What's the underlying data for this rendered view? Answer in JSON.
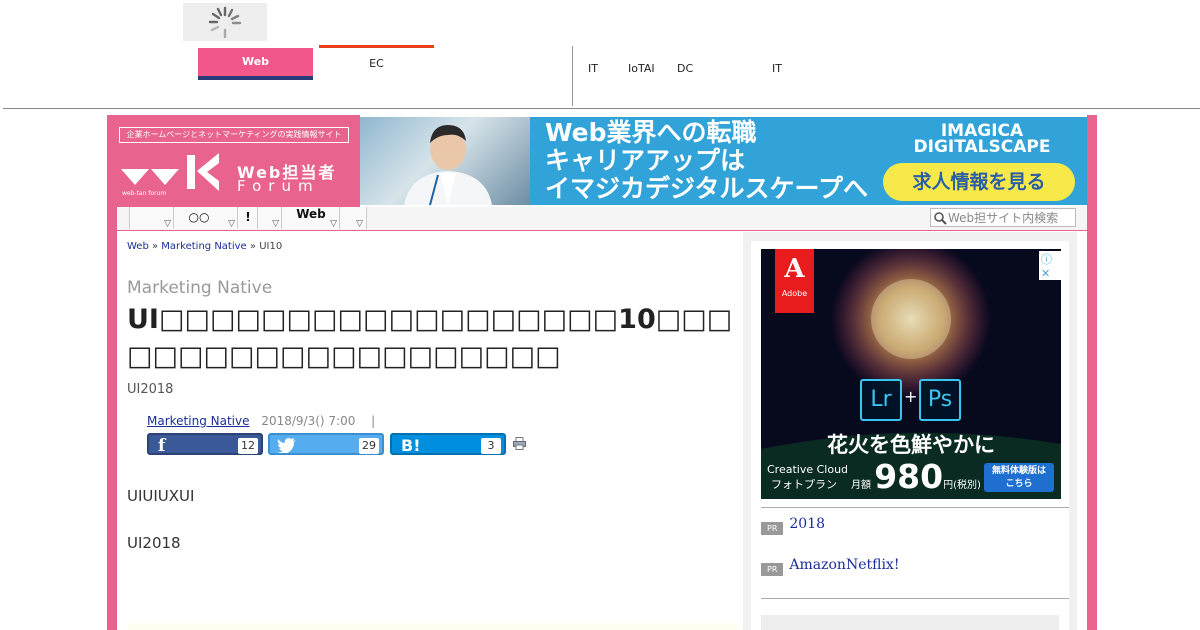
{
  "header": {
    "tabs": [
      {
        "label": "Web"
      },
      {
        "label": "EC"
      }
    ],
    "links": [
      "IT",
      "IoTAI",
      "DC",
      "IT"
    ]
  },
  "site": {
    "tagline": "企業ホームページとネットマーケティングの実践情報サイト",
    "logo_title": "Web担当者",
    "logo_sub": "Forum",
    "logo_mark": "web-tan forum"
  },
  "banner_ad": {
    "headline_1": "Web業界への転職",
    "headline_2": "キャリアアップは",
    "headline_3": "イマジカデジタルスケープへ",
    "brand_1": "IMAGICA",
    "brand_2": "DIGITALSCAPE",
    "cta": "求人情報を見る"
  },
  "nav": {
    "items": [
      "",
      "○○",
      "!",
      "",
      "Web",
      ""
    ],
    "search_placeholder": "Web担サイト内検索"
  },
  "breadcrumb": {
    "home": "Web",
    "sep1": " » ",
    "section": "Marketing Native",
    "sep2": " » ",
    "current": "UI10"
  },
  "article": {
    "category": "Marketing Native",
    "title": "UI□□□□□□□□□□□□□□□□□□10□□□□□□□□□□□□□□□□□□□□",
    "subtitle": "UI2018",
    "author": "Marketing Native",
    "date": "2018/9/3() 7:00",
    "date_sep": "|",
    "body_1": "UIUIUXUI",
    "body_2": "UI2018"
  },
  "share": {
    "facebook_count": "12",
    "twitter_count": "29",
    "hatena_label": "B!",
    "hatena_count": "3",
    "colors": {
      "facebook": "#3b5998",
      "twitter": "#55acee",
      "hatena": "#008fde"
    }
  },
  "sidebar": {
    "ad": {
      "brand": "Adobe",
      "app1": "Lr",
      "app2": "Ps",
      "catch": "花火を色鮮やかに",
      "product_1": "Creative Cloud",
      "product_2": "フォトプラン",
      "price_prefix": "月額",
      "price": "980",
      "price_suffix": "円(税別)",
      "trial_1": "無料体験版は",
      "trial_2": "こちら"
    },
    "pr": [
      {
        "badge": "PR",
        "text": "2018"
      },
      {
        "badge": "PR",
        "text": "AmazonNetflix!"
      }
    ]
  }
}
